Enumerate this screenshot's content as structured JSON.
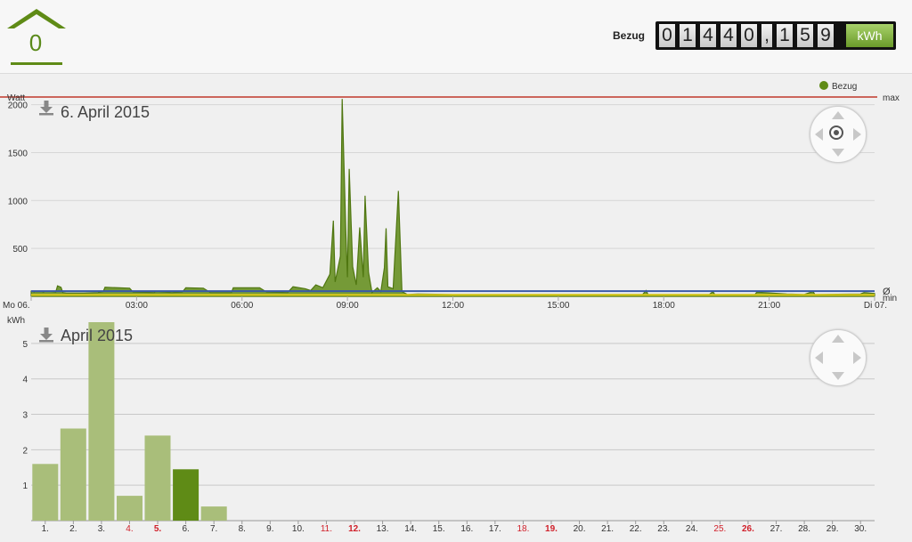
{
  "header": {
    "home_value": "0",
    "meter_label": "Bezug",
    "meter_digits": [
      "0",
      "1",
      "4",
      "4",
      "0",
      ",",
      "1",
      "5",
      "9"
    ],
    "meter_unit": "kWh"
  },
  "colors": {
    "accent": "#5f8b16",
    "max_line": "#c0392b",
    "avg_line": "#3a5aa8",
    "min_line": "#e3cf1a",
    "bar_light": "#a9be7a",
    "bar_current": "#5f8b16"
  },
  "chart_data": [
    {
      "type": "area",
      "title": "6. April 2015",
      "ylabel": "Watt",
      "ylim": [
        0,
        2080
      ],
      "yticks": [
        "500",
        "1000",
        "1500",
        "2000"
      ],
      "x_ticks": [
        "Mo 06.",
        "03:00",
        "06:00",
        "09:00",
        "12:00",
        "15:00",
        "18:00",
        "21:00",
        "Di 07."
      ],
      "legend": "Bezug",
      "right_labels": {
        "max": "max",
        "avg": "Ø",
        "min": "min"
      },
      "series": [
        {
          "name": "Bezug",
          "points": [
            [
              0.0,
              55
            ],
            [
              0.05,
              55
            ],
            [
              0.08,
              45
            ],
            [
              0.1,
              50
            ],
            [
              0.2,
              50
            ],
            [
              0.3,
              50
            ],
            [
              0.35,
              45
            ],
            [
              0.4,
              55
            ],
            [
              0.5,
              55
            ],
            [
              0.6,
              50
            ],
            [
              0.7,
              45
            ],
            [
              0.75,
              110
            ],
            [
              0.85,
              95
            ],
            [
              0.9,
              40
            ],
            [
              1.0,
              35
            ],
            [
              1.5,
              35
            ],
            [
              1.9,
              40
            ],
            [
              2.05,
              50
            ],
            [
              2.1,
              95
            ],
            [
              2.8,
              85
            ],
            [
              2.9,
              45
            ],
            [
              3.5,
              40
            ],
            [
              3.55,
              50
            ],
            [
              4.0,
              40
            ],
            [
              4.3,
              45
            ],
            [
              4.4,
              90
            ],
            [
              4.9,
              85
            ],
            [
              5.1,
              40
            ],
            [
              5.7,
              40
            ],
            [
              5.75,
              90
            ],
            [
              6.5,
              90
            ],
            [
              6.7,
              45
            ],
            [
              7.3,
              40
            ],
            [
              7.45,
              100
            ],
            [
              7.8,
              80
            ],
            [
              7.95,
              60
            ],
            [
              8.1,
              120
            ],
            [
              8.3,
              90
            ],
            [
              8.5,
              230
            ],
            [
              8.6,
              790
            ],
            [
              8.65,
              150
            ],
            [
              8.8,
              420
            ],
            [
              8.85,
              2060
            ],
            [
              8.95,
              700
            ],
            [
              9.0,
              200
            ],
            [
              9.05,
              1330
            ],
            [
              9.15,
              310
            ],
            [
              9.25,
              120
            ],
            [
              9.35,
              720
            ],
            [
              9.45,
              200
            ],
            [
              9.5,
              1050
            ],
            [
              9.6,
              250
            ],
            [
              9.7,
              40
            ],
            [
              9.85,
              90
            ],
            [
              9.95,
              50
            ],
            [
              10.05,
              300
            ],
            [
              10.1,
              710
            ],
            [
              10.15,
              100
            ],
            [
              10.3,
              80
            ],
            [
              10.45,
              1100
            ],
            [
              10.55,
              50
            ],
            [
              10.7,
              20
            ],
            [
              11.0,
              25
            ],
            [
              12.0,
              20
            ],
            [
              14.0,
              20
            ],
            [
              16.0,
              20
            ],
            [
              17.4,
              20
            ],
            [
              17.5,
              60
            ],
            [
              17.55,
              20
            ],
            [
              19.3,
              20
            ],
            [
              19.4,
              50
            ],
            [
              19.45,
              20
            ],
            [
              20.6,
              20
            ],
            [
              20.65,
              45
            ],
            [
              21.5,
              25
            ],
            [
              22.0,
              20
            ],
            [
              22.25,
              50
            ],
            [
              22.3,
              20
            ],
            [
              23.6,
              25
            ],
            [
              23.7,
              40
            ],
            [
              24.0,
              30
            ]
          ]
        }
      ],
      "max": 2080,
      "avg": 55,
      "min": 15
    },
    {
      "type": "bar",
      "title": "April 2015",
      "ylabel": "kWh",
      "ylim": [
        0,
        5.6
      ],
      "yticks": [
        "1",
        "2",
        "3",
        "4",
        "5"
      ],
      "categories": [
        "1.",
        "2.",
        "3.",
        "4.",
        "5.",
        "6.",
        "7.",
        "8.",
        "9.",
        "10.",
        "11.",
        "12.",
        "13.",
        "14.",
        "15.",
        "16.",
        "17.",
        "18.",
        "19.",
        "20.",
        "21.",
        "22.",
        "23.",
        "24.",
        "25.",
        "26.",
        "27.",
        "28.",
        "29.",
        "30."
      ],
      "values": [
        1.6,
        2.6,
        5.6,
        0.7,
        2.4,
        1.45,
        0.4,
        0,
        0,
        0,
        0,
        0,
        0,
        0,
        0,
        0,
        0,
        0,
        0,
        0,
        0,
        0,
        0,
        0,
        0,
        0,
        0,
        0,
        0,
        0
      ],
      "current_index": 5,
      "red_days": [
        3,
        4,
        10,
        11,
        17,
        18,
        24,
        25
      ],
      "bold_days": [
        4,
        11,
        18,
        25
      ]
    }
  ]
}
